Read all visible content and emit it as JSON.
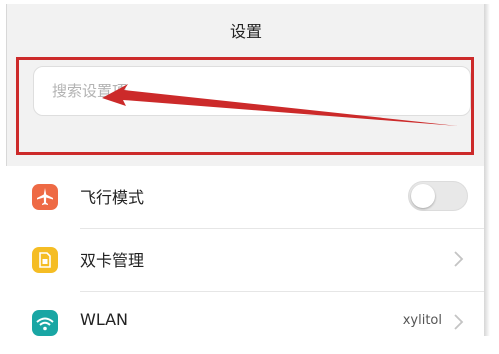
{
  "header": {
    "title": "设置"
  },
  "search": {
    "placeholder": "搜索设置项"
  },
  "colors": {
    "highlight": "#cc2a2a",
    "airplane": "#ee6a45",
    "sim": "#f5bd24",
    "wifi": "#19a6a4"
  },
  "settings": {
    "items": [
      {
        "label": "飞行模式",
        "icon": "airplane-icon",
        "control": "toggle",
        "state": "off"
      },
      {
        "label": "双卡管理",
        "icon": "sim-card-icon",
        "control": "chevron"
      },
      {
        "label": "WLAN",
        "icon": "wifi-icon",
        "control": "chevron",
        "value": "xylitol"
      }
    ]
  }
}
